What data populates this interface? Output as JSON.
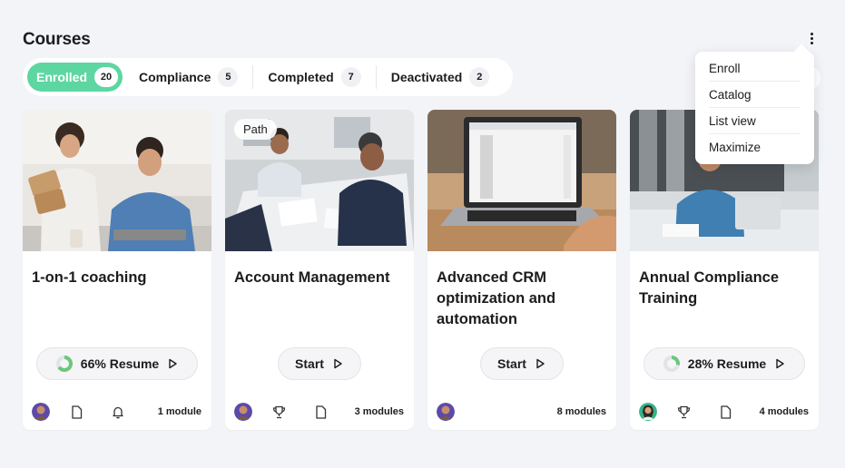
{
  "page": {
    "title": "Courses"
  },
  "tabs": [
    {
      "label": "Enrolled",
      "count": "20",
      "active": true
    },
    {
      "label": "Compliance",
      "count": "5"
    },
    {
      "label": "Completed",
      "count": "7"
    },
    {
      "label": "Deactivated",
      "count": "2"
    }
  ],
  "menu": {
    "items": [
      "Enroll",
      "Catalog",
      "List view",
      "Maximize"
    ]
  },
  "cards": [
    {
      "title": "1-on-1 coaching",
      "action": "66% Resume",
      "progress": 0.66,
      "modules": "1 module",
      "icons": [
        "document-icon",
        "bell-icon"
      ]
    },
    {
      "tag": "Path",
      "title": "Account Management",
      "action": "Start",
      "modules": "3 modules",
      "icons": [
        "trophy-icon",
        "document-icon"
      ]
    },
    {
      "title": "Advanced CRM optimization and automation",
      "action": "Start",
      "modules": "8 modules",
      "icons": []
    },
    {
      "title": "Annual Compliance Training",
      "action": "28% Resume",
      "progress": 0.28,
      "modules": "4 modules",
      "icons": [
        "trophy-icon",
        "document-icon"
      ]
    }
  ],
  "colors": {
    "accent": "#5dd6a2",
    "progress": "#6cc77a",
    "background": "#f3f4f8"
  }
}
